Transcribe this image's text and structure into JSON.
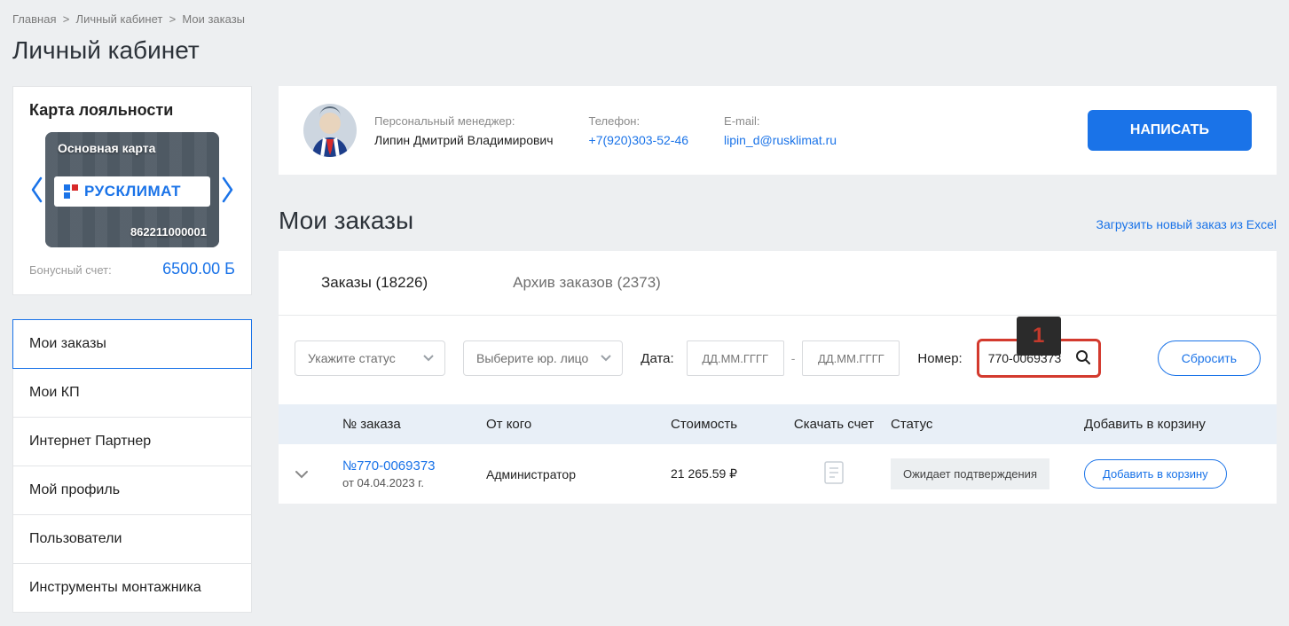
{
  "breadcrumb": {
    "home": "Главная",
    "account": "Личный кабинет",
    "orders": "Мои заказы"
  },
  "page_title": "Личный кабинет",
  "loyalty": {
    "title": "Карта лояльности",
    "card_name": "Основная карта",
    "brand_text": "РУСКЛИМАТ",
    "card_number": "862211000001",
    "bonus_label": "Бонусный счет:",
    "bonus_value": "6500.00 Б"
  },
  "nav": {
    "my_orders": "Мои заказы",
    "my_kp": "Мои КП",
    "partner": "Интернет Партнер",
    "profile": "Мой профиль",
    "users": "Пользователи",
    "tools": "Инструменты монтажника"
  },
  "manager": {
    "label_manager": "Персональный менеджер:",
    "name": "Липин Дмитрий Владимирович",
    "label_phone": "Телефон:",
    "phone": "+7(920)303-52-46",
    "label_email": "E-mail:",
    "email": "lipin_d@rusklimat.ru",
    "write_btn": "НАПИСАТЬ"
  },
  "orders_section": {
    "title": "Мои заказы",
    "excel_link": "Загрузить новый заказ из Excel",
    "tab_orders_label": "Заказы",
    "tab_orders_count": "(18226)",
    "tab_archive_label": "Архив заказов",
    "tab_archive_count": "(2373)"
  },
  "filters": {
    "status_placeholder": "Укажите статус",
    "legal_placeholder": "Выберите юр. лицо",
    "date_label": "Дата:",
    "date_placeholder": "ДД.ММ.ГГГГ",
    "number_label": "Номер:",
    "number_value": "770-0069373",
    "badge": "1",
    "reset": "Сбросить"
  },
  "table": {
    "h_number": "№ заказа",
    "h_from": "От кого",
    "h_cost": "Стоимость",
    "h_download": "Скачать счет",
    "h_status": "Статус",
    "h_cart": "Добавить в корзину",
    "row": {
      "order_no": "№770-0069373",
      "order_date": "от 04.04.2023 г.",
      "from": "Администратор",
      "cost": "21 265.59 ₽",
      "status": "Ожидает подтверждения",
      "add_cart": "Добавить в корзину"
    }
  }
}
